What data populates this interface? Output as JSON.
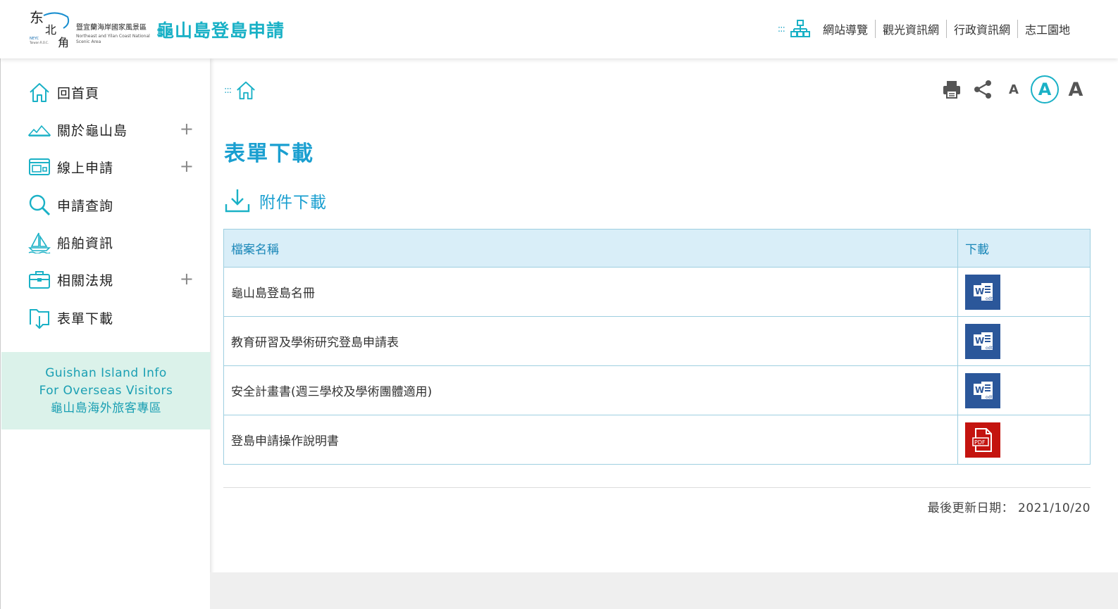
{
  "header": {
    "logo_org_zh": "暨宜蘭海岸國家風景區",
    "logo_org_en": "Northeast and Yilan Coast National Scenic Area",
    "logo_small": "NEYC",
    "logo_small2": "Taiwan R.O.C.",
    "site_title": "龜山島登島申請",
    "nav": {
      "dots": ":::",
      "items": [
        "網站導覽",
        "觀光資訊網",
        "行政資訊網",
        "志工園地"
      ]
    }
  },
  "sidebar": {
    "items": [
      {
        "label": "回首頁",
        "icon": "home-icon",
        "expandable": false
      },
      {
        "label": "關於龜山島",
        "icon": "mountain-icon",
        "expandable": true
      },
      {
        "label": "線上申請",
        "icon": "web-form-icon",
        "expandable": true
      },
      {
        "label": "申請查詢",
        "icon": "magnifier-icon",
        "expandable": false
      },
      {
        "label": "船舶資訊",
        "icon": "boat-icon",
        "expandable": false
      },
      {
        "label": "相關法規",
        "icon": "briefcase-icon",
        "expandable": true
      },
      {
        "label": "表單下載",
        "icon": "folder-download-icon",
        "expandable": false
      }
    ],
    "plus_symbol": "+",
    "overseas": {
      "line1": "Guishan Island Info",
      "line2": "For Overseas Visitors",
      "line3": "龜山島海外旅客專區"
    }
  },
  "main": {
    "breadcrumb_dots": ":::",
    "tools": {
      "font_small": "A",
      "font_medium": "A",
      "font_large": "A"
    },
    "page_title": "表單下載",
    "section_title": "附件下載",
    "table": {
      "headers": [
        "檔案名稱",
        "下載"
      ],
      "rows": [
        {
          "name": "龜山島登島名冊",
          "type": "odt"
        },
        {
          "name": "教育研習及學術研究登島申請表",
          "type": "odt"
        },
        {
          "name": "安全計畫書(週三學校及學術團體適用)",
          "type": "odt"
        },
        {
          "name": "登島申請操作說明書",
          "type": "pdf"
        }
      ]
    },
    "last_updated_label": "最後更新日期：",
    "last_updated": "2021/10/20"
  },
  "colors": {
    "accent": "#1ab1c6",
    "title_blue": "#1a9fd0",
    "word_blue": "#2b579a",
    "pdf_red": "#c4140f",
    "overseas_bg": "#dbf2ea"
  }
}
